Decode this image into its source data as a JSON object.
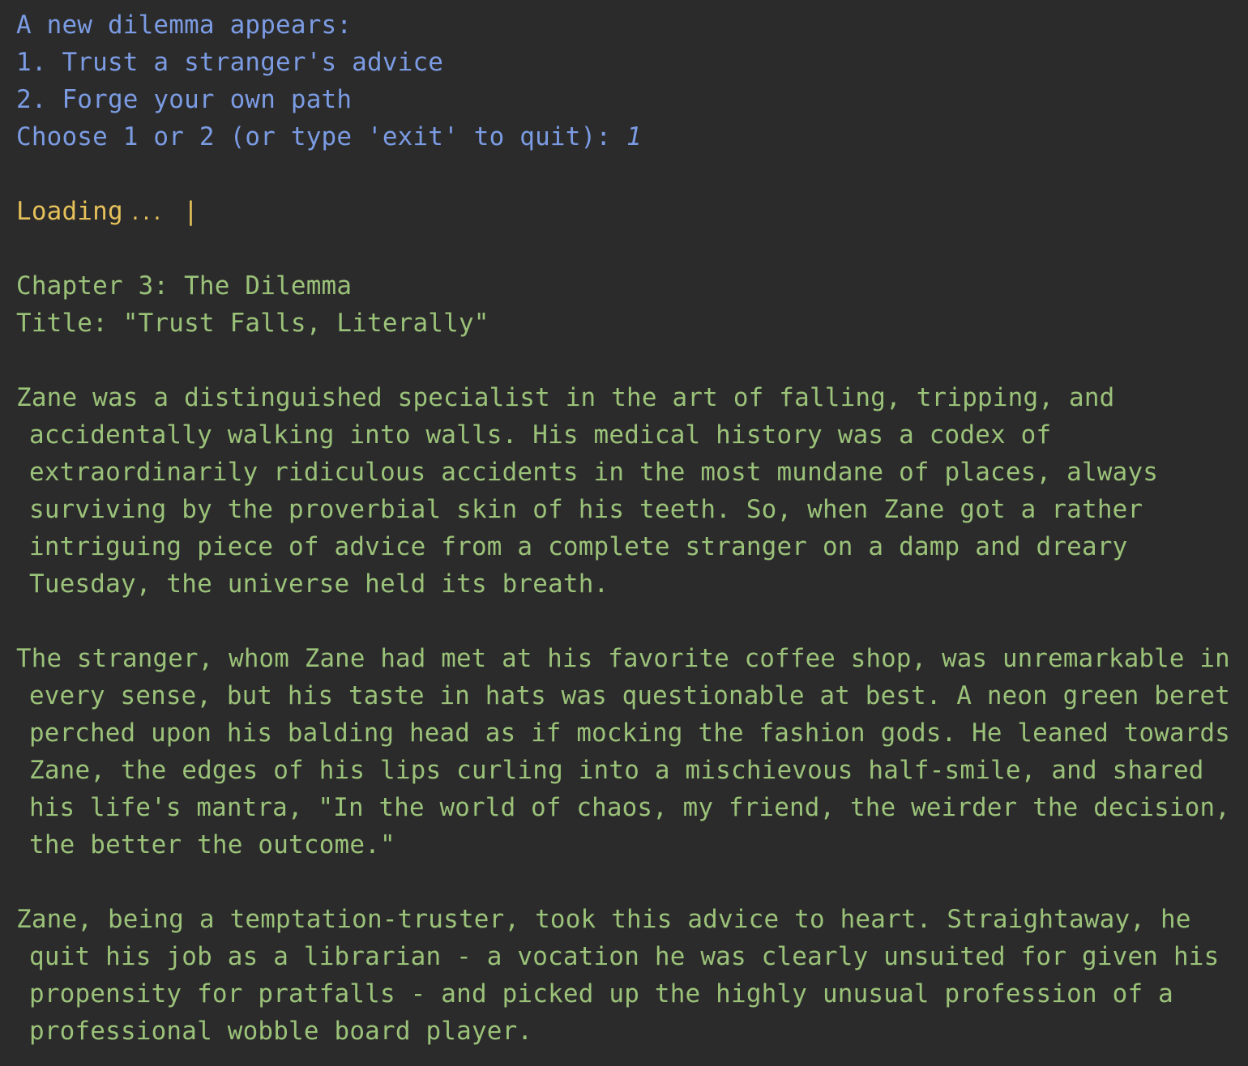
{
  "colors": {
    "background": "#2b2b2b",
    "prompt_text": "#7b9be3",
    "loading_text": "#e6c15a",
    "story_text": "#9bc279"
  },
  "prompt": {
    "header": "A new dilemma appears:",
    "option_1": "1. Trust a stranger's advice",
    "option_2": "2. Forge your own path",
    "question": "Choose 1 or 2 (or type 'exit' to quit): ",
    "answer": "1"
  },
  "loading": {
    "label": "Loading",
    "dots": "...",
    "spinner": "|"
  },
  "story": {
    "chapter": "Chapter 3: The Dilemma",
    "title": "Title: \"Trust Falls, Literally\"",
    "paragraphs": [
      {
        "lines": [
          "Zane was a distinguished specialist in the art of falling, tripping, and",
          "accidentally walking into walls. His medical history was a codex of",
          "extraordinarily ridiculous accidents in the most mundane of places, always",
          "surviving by the proverbial skin of his teeth. So, when Zane got a rather",
          "intriguing piece of advice from a complete stranger on a damp and dreary",
          "Tuesday, the universe held its breath."
        ]
      },
      {
        "lines": [
          "The stranger, whom Zane had met at his favorite coffee shop, was unremarkable in",
          "every sense, but his taste in hats was questionable at best. A neon green beret",
          "perched upon his balding head as if mocking the fashion gods. He leaned towards",
          "Zane, the edges of his lips curling into a mischievous half-smile, and shared",
          "his life's mantra, \"In the world of chaos, my friend, the weirder the decision,",
          "the better the outcome.\""
        ]
      },
      {
        "lines": [
          "Zane, being a temptation-truster, took this advice to heart. Straightaway, he",
          "quit his job as a librarian - a vocation he was clearly unsuited for given his",
          "propensity for pratfalls - and picked up the highly unusual profession of a",
          "professional wobble board player."
        ]
      }
    ]
  }
}
